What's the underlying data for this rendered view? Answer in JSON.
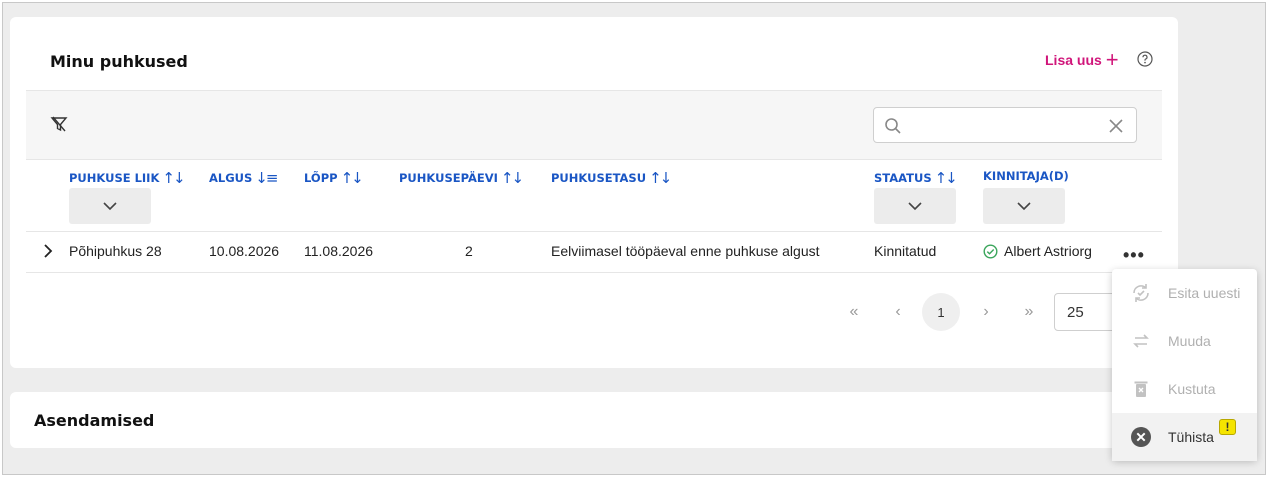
{
  "vacations": {
    "title": "Minu puhkused",
    "add_label": "Lisa uus",
    "search": {
      "value": "",
      "placeholder": ""
    },
    "columns": {
      "type": "PUHKUSE LIIK",
      "start": "ALGUS",
      "end": "LÕPP",
      "days": "PUHKUSEPÄEVI",
      "pay": "PUHKUSETASU",
      "status": "STAATUS",
      "approvers": "KINNITAJA(D)"
    },
    "rows": [
      {
        "type": "Põhipuhkus 28",
        "start": "10.08.2026",
        "end": "11.08.2026",
        "days": "2",
        "pay": "Eelviimasel tööpäeval enne puhkuse algust",
        "status": "Kinnitatud",
        "approver": "Albert Astriorg"
      }
    ],
    "pagination": {
      "current_page": "1",
      "page_size": "25"
    }
  },
  "substitutions": {
    "title": "Asendamised"
  },
  "context_menu": {
    "items": [
      {
        "label": "Esita uuesti",
        "icon": "resubmit-icon",
        "enabled": false
      },
      {
        "label": "Muuda",
        "icon": "swap-icon",
        "enabled": false
      },
      {
        "label": "Kustuta",
        "icon": "trash-icon",
        "enabled": false
      },
      {
        "label": "Tühista",
        "icon": "cancel-circle-icon",
        "enabled": true,
        "badge": "!"
      }
    ]
  },
  "colors": {
    "accent": "#d0157a",
    "header_link": "#1a56c4",
    "approved_green": "#3aa55b",
    "warning_yellow": "#f5e400"
  }
}
